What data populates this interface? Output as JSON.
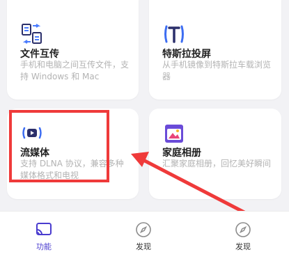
{
  "colors": {
    "accent": "#4a3ccf",
    "highlight": "#ef3a3a",
    "muted": "#b3b3b3"
  },
  "cards": [
    {
      "title": "文件互传",
      "desc": "手机和电脑之间互传文件，支持 Windows 和 Mac",
      "icon": "file-transfer-icon"
    },
    {
      "title": "特斯拉投屏",
      "desc": "从手机镜像到特斯拉车载浏览器",
      "icon": "tesla-icon"
    },
    {
      "title": "流媒体",
      "desc": "支持 DLNA 协议，兼容多种媒体格式和电视",
      "icon": "streaming-icon"
    },
    {
      "title": "家庭相册",
      "desc": "汇聚家庭相册，回忆美好瞬间",
      "icon": "photo-album-icon"
    }
  ],
  "nav": [
    {
      "label": "功能",
      "icon": "cast-icon",
      "active": true
    },
    {
      "label": "发现",
      "icon": "compass-icon",
      "active": false
    },
    {
      "label": "发现",
      "icon": "compass-icon",
      "active": false
    }
  ]
}
